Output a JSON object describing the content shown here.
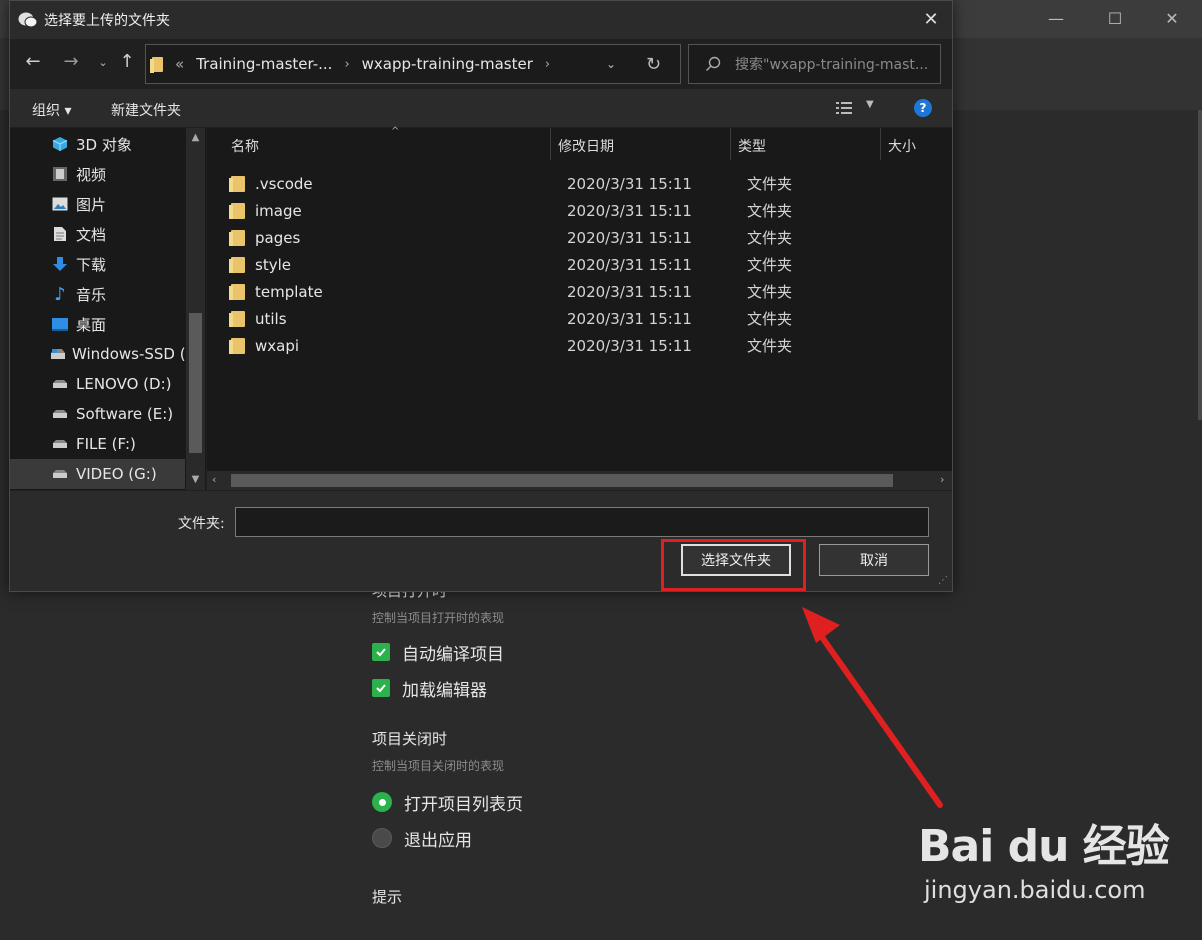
{
  "dialog": {
    "title": "选择要上传的文件夹",
    "address": {
      "overflow": "«",
      "crumbs": [
        "Training-master-...",
        "wxapp-training-master"
      ]
    },
    "search_placeholder": "搜索\"wxapp-training-mast...",
    "commands": {
      "organize": "组织 ▾",
      "new_folder": "新建文件夹"
    },
    "nav_items": [
      {
        "label": "3D 对象",
        "icon": "cube-icon"
      },
      {
        "label": "视频",
        "icon": "video-icon"
      },
      {
        "label": "图片",
        "icon": "picture-icon"
      },
      {
        "label": "文档",
        "icon": "document-icon"
      },
      {
        "label": "下载",
        "icon": "download-icon"
      },
      {
        "label": "音乐",
        "icon": "music-icon"
      },
      {
        "label": "桌面",
        "icon": "desktop-icon"
      },
      {
        "label": "Windows-SSD (",
        "icon": "drive-icon"
      },
      {
        "label": "LENOVO (D:)",
        "icon": "drive-icon"
      },
      {
        "label": "Software (E:)",
        "icon": "drive-icon"
      },
      {
        "label": "FILE (F:)",
        "icon": "drive-icon"
      },
      {
        "label": "VIDEO (G:)",
        "icon": "drive-icon"
      }
    ],
    "columns": {
      "name": "名称",
      "date": "修改日期",
      "type": "类型",
      "size": "大小"
    },
    "files": [
      {
        "name": ".vscode",
        "date": "2020/3/31 15:11",
        "type": "文件夹"
      },
      {
        "name": "image",
        "date": "2020/3/31 15:11",
        "type": "文件夹"
      },
      {
        "name": "pages",
        "date": "2020/3/31 15:11",
        "type": "文件夹"
      },
      {
        "name": "style",
        "date": "2020/3/31 15:11",
        "type": "文件夹"
      },
      {
        "name": "template",
        "date": "2020/3/31 15:11",
        "type": "文件夹"
      },
      {
        "name": "utils",
        "date": "2020/3/31 15:11",
        "type": "文件夹"
      },
      {
        "name": "wxapi",
        "date": "2020/3/31 15:11",
        "type": "文件夹"
      }
    ],
    "folder_label": "文件夹:",
    "folder_value": "",
    "select_button": "选择文件夹",
    "cancel_button": "取消"
  },
  "background": {
    "on_open_title": "项目打开时",
    "on_open_desc": "控制当项目打开时的表现",
    "on_open_options": [
      "自动编译项目",
      "加载编辑器"
    ],
    "on_close_title": "项目关闭时",
    "on_close_desc": "控制当项目关闭时的表现",
    "on_close_options": [
      {
        "label": "打开项目列表页",
        "selected": true
      },
      {
        "label": "退出应用",
        "selected": false
      }
    ],
    "tips_title": "提示"
  },
  "watermark": {
    "main": "Bai du 经验",
    "sub": "jingyan.baidu.com"
  },
  "colors": {
    "accent_green": "#2bb24c",
    "highlight_red": "#e02020",
    "help_blue": "#1e76d6"
  }
}
